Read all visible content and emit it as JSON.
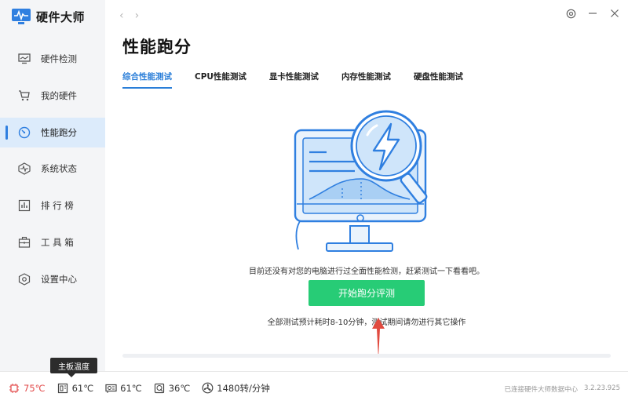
{
  "app": {
    "title": "硬件大师"
  },
  "sidebar": {
    "items": [
      {
        "label": "硬件检测",
        "icon": "monitor-icon",
        "active": false
      },
      {
        "label": "我的硬件",
        "icon": "cart-icon",
        "active": false
      },
      {
        "label": "性能跑分",
        "icon": "speedometer-icon",
        "active": true
      },
      {
        "label": "系统状态",
        "icon": "pulse-icon",
        "active": false
      },
      {
        "label": "排 行 榜",
        "icon": "ranking-icon",
        "active": false
      },
      {
        "label": "工 具 箱",
        "icon": "toolbox-icon",
        "active": false
      },
      {
        "label": "设置中心",
        "icon": "hexagon-settings-icon",
        "active": false
      }
    ]
  },
  "nav": {
    "back": "‹",
    "forward": "›"
  },
  "main": {
    "title": "性能跑分",
    "tabs": [
      {
        "label": "综合性能测试",
        "active": true
      },
      {
        "label": "CPU性能测试",
        "active": false
      },
      {
        "label": "显卡性能测试",
        "active": false
      },
      {
        "label": "内存性能测试",
        "active": false
      },
      {
        "label": "硬盘性能测试",
        "active": false
      }
    ],
    "description": "目前还没有对您的电脑进行过全面性能检测，赶紧测试一下看看吧。",
    "start_button": "开始跑分评测",
    "note": "全部测试预计耗时8-10分钟，测试期间请勿进行其它操作",
    "progress": 0
  },
  "tooltip": "主板温度",
  "status": {
    "items": [
      {
        "value": "75℃",
        "icon": "cpu-chip-icon",
        "hot": true
      },
      {
        "value": "61℃",
        "icon": "motherboard-icon",
        "hot": false
      },
      {
        "value": "61℃",
        "icon": "gpu-icon",
        "hot": false
      },
      {
        "value": "36℃",
        "icon": "disk-icon",
        "hot": false
      },
      {
        "value": "1480转/分钟",
        "icon": "fan-icon",
        "hot": false
      }
    ],
    "connection": "已连接硬件大师数据中心",
    "version": "3.2.23.925"
  },
  "colors": {
    "accent": "#2a7ed8",
    "button": "#27cc76",
    "hot": "#e24a4a"
  }
}
